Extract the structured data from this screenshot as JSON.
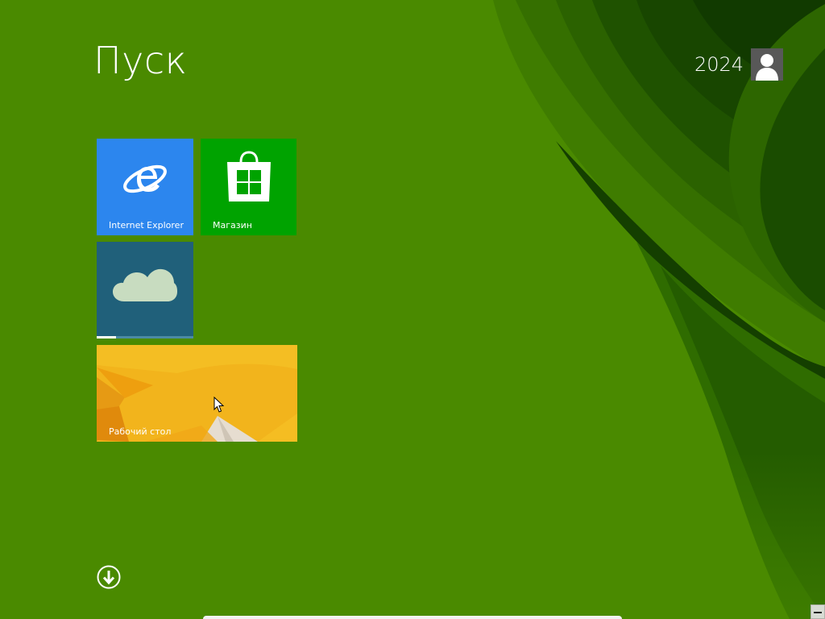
{
  "screen": {
    "title": "Пуск",
    "background_color": "#4a8a00"
  },
  "user": {
    "name": "2024",
    "avatar_icon": "user-silhouette-icon"
  },
  "tiles": [
    {
      "id": "ie",
      "label": "Internet Explorer",
      "color": "#2c86ee",
      "icon": "internet-explorer-icon"
    },
    {
      "id": "store",
      "label": "Магазин",
      "color": "#00a300",
      "icon": "store-bag-icon"
    },
    {
      "id": "onedrive",
      "label": "",
      "color": "#20607a",
      "icon": "onedrive-cloud-icon",
      "progress": 0.2
    },
    {
      "id": "desktop",
      "label": "Рабочий стол",
      "color": "#f0b21a",
      "icon": "desktop-wallpaper-preview"
    }
  ],
  "apps_button": {
    "icon": "arrow-down-circle-icon"
  },
  "colors": {
    "accent": "#4a8a00",
    "wallpaper_dark": "#1d4f00"
  }
}
